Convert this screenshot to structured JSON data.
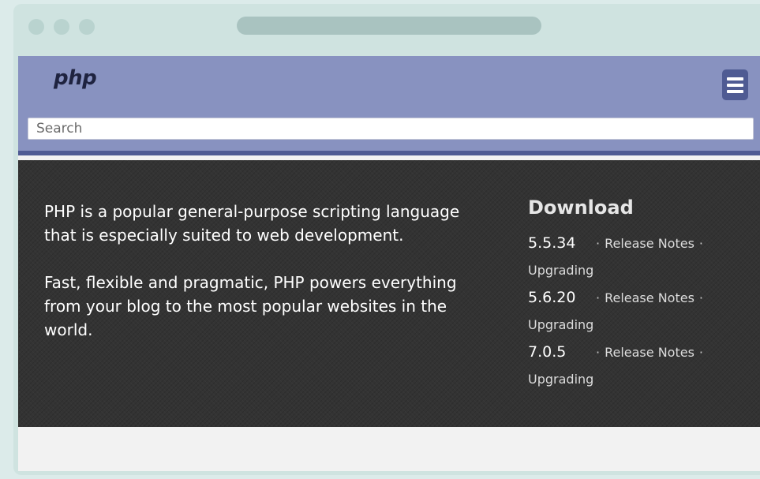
{
  "header": {
    "logo_text": "php",
    "menu_icon": "hamburger-menu-icon"
  },
  "search": {
    "placeholder": "Search"
  },
  "intro": {
    "paragraph1": "PHP is a popular general-purpose scripting language that is especially suited to web development.",
    "paragraph2": "Fast, flexible and pragmatic, PHP powers everything from your blog to the most popular websites in the world."
  },
  "download": {
    "heading": "Download",
    "releases": [
      {
        "version": "5.5.34",
        "notes_label": "Release Notes",
        "upgrading_label": "Upgrading"
      },
      {
        "version": "5.6.20",
        "notes_label": "Release Notes",
        "upgrading_label": "Upgrading"
      },
      {
        "version": "7.0.5",
        "notes_label": "Release Notes",
        "upgrading_label": "Upgrading"
      }
    ],
    "separator": "·"
  },
  "colors": {
    "header_bg": "#8892c0",
    "header_accent": "#4f5b93",
    "hero_bg": "#333333",
    "browser_frame": "#cfe3e0"
  }
}
